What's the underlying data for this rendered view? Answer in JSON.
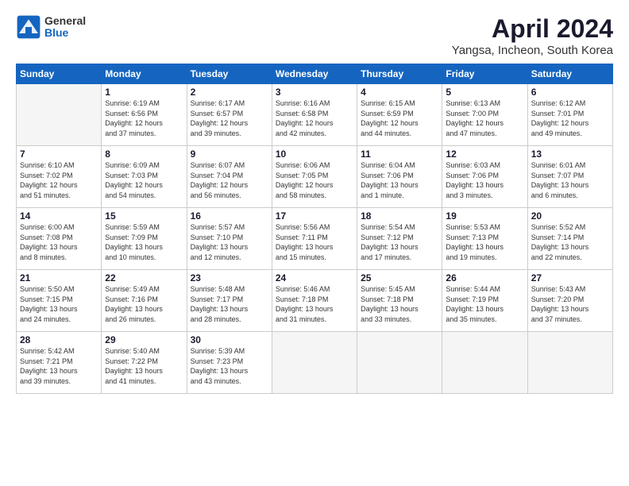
{
  "logo": {
    "general": "General",
    "blue": "Blue"
  },
  "title": "April 2024",
  "subtitle": "Yangsa, Incheon, South Korea",
  "weekdays": [
    "Sunday",
    "Monday",
    "Tuesday",
    "Wednesday",
    "Thursday",
    "Friday",
    "Saturday"
  ],
  "weeks": [
    [
      {
        "day": "",
        "empty": true
      },
      {
        "day": "1",
        "sunrise": "Sunrise: 6:19 AM",
        "sunset": "Sunset: 6:56 PM",
        "daylight": "Daylight: 12 hours and 37 minutes."
      },
      {
        "day": "2",
        "sunrise": "Sunrise: 6:17 AM",
        "sunset": "Sunset: 6:57 PM",
        "daylight": "Daylight: 12 hours and 39 minutes."
      },
      {
        "day": "3",
        "sunrise": "Sunrise: 6:16 AM",
        "sunset": "Sunset: 6:58 PM",
        "daylight": "Daylight: 12 hours and 42 minutes."
      },
      {
        "day": "4",
        "sunrise": "Sunrise: 6:15 AM",
        "sunset": "Sunset: 6:59 PM",
        "daylight": "Daylight: 12 hours and 44 minutes."
      },
      {
        "day": "5",
        "sunrise": "Sunrise: 6:13 AM",
        "sunset": "Sunset: 7:00 PM",
        "daylight": "Daylight: 12 hours and 47 minutes."
      },
      {
        "day": "6",
        "sunrise": "Sunrise: 6:12 AM",
        "sunset": "Sunset: 7:01 PM",
        "daylight": "Daylight: 12 hours and 49 minutes."
      }
    ],
    [
      {
        "day": "7",
        "sunrise": "Sunrise: 6:10 AM",
        "sunset": "Sunset: 7:02 PM",
        "daylight": "Daylight: 12 hours and 51 minutes."
      },
      {
        "day": "8",
        "sunrise": "Sunrise: 6:09 AM",
        "sunset": "Sunset: 7:03 PM",
        "daylight": "Daylight: 12 hours and 54 minutes."
      },
      {
        "day": "9",
        "sunrise": "Sunrise: 6:07 AM",
        "sunset": "Sunset: 7:04 PM",
        "daylight": "Daylight: 12 hours and 56 minutes."
      },
      {
        "day": "10",
        "sunrise": "Sunrise: 6:06 AM",
        "sunset": "Sunset: 7:05 PM",
        "daylight": "Daylight: 12 hours and 58 minutes."
      },
      {
        "day": "11",
        "sunrise": "Sunrise: 6:04 AM",
        "sunset": "Sunset: 7:06 PM",
        "daylight": "Daylight: 13 hours and 1 minute."
      },
      {
        "day": "12",
        "sunrise": "Sunrise: 6:03 AM",
        "sunset": "Sunset: 7:06 PM",
        "daylight": "Daylight: 13 hours and 3 minutes."
      },
      {
        "day": "13",
        "sunrise": "Sunrise: 6:01 AM",
        "sunset": "Sunset: 7:07 PM",
        "daylight": "Daylight: 13 hours and 6 minutes."
      }
    ],
    [
      {
        "day": "14",
        "sunrise": "Sunrise: 6:00 AM",
        "sunset": "Sunset: 7:08 PM",
        "daylight": "Daylight: 13 hours and 8 minutes."
      },
      {
        "day": "15",
        "sunrise": "Sunrise: 5:59 AM",
        "sunset": "Sunset: 7:09 PM",
        "daylight": "Daylight: 13 hours and 10 minutes."
      },
      {
        "day": "16",
        "sunrise": "Sunrise: 5:57 AM",
        "sunset": "Sunset: 7:10 PM",
        "daylight": "Daylight: 13 hours and 12 minutes."
      },
      {
        "day": "17",
        "sunrise": "Sunrise: 5:56 AM",
        "sunset": "Sunset: 7:11 PM",
        "daylight": "Daylight: 13 hours and 15 minutes."
      },
      {
        "day": "18",
        "sunrise": "Sunrise: 5:54 AM",
        "sunset": "Sunset: 7:12 PM",
        "daylight": "Daylight: 13 hours and 17 minutes."
      },
      {
        "day": "19",
        "sunrise": "Sunrise: 5:53 AM",
        "sunset": "Sunset: 7:13 PM",
        "daylight": "Daylight: 13 hours and 19 minutes."
      },
      {
        "day": "20",
        "sunrise": "Sunrise: 5:52 AM",
        "sunset": "Sunset: 7:14 PM",
        "daylight": "Daylight: 13 hours and 22 minutes."
      }
    ],
    [
      {
        "day": "21",
        "sunrise": "Sunrise: 5:50 AM",
        "sunset": "Sunset: 7:15 PM",
        "daylight": "Daylight: 13 hours and 24 minutes."
      },
      {
        "day": "22",
        "sunrise": "Sunrise: 5:49 AM",
        "sunset": "Sunset: 7:16 PM",
        "daylight": "Daylight: 13 hours and 26 minutes."
      },
      {
        "day": "23",
        "sunrise": "Sunrise: 5:48 AM",
        "sunset": "Sunset: 7:17 PM",
        "daylight": "Daylight: 13 hours and 28 minutes."
      },
      {
        "day": "24",
        "sunrise": "Sunrise: 5:46 AM",
        "sunset": "Sunset: 7:18 PM",
        "daylight": "Daylight: 13 hours and 31 minutes."
      },
      {
        "day": "25",
        "sunrise": "Sunrise: 5:45 AM",
        "sunset": "Sunset: 7:18 PM",
        "daylight": "Daylight: 13 hours and 33 minutes."
      },
      {
        "day": "26",
        "sunrise": "Sunrise: 5:44 AM",
        "sunset": "Sunset: 7:19 PM",
        "daylight": "Daylight: 13 hours and 35 minutes."
      },
      {
        "day": "27",
        "sunrise": "Sunrise: 5:43 AM",
        "sunset": "Sunset: 7:20 PM",
        "daylight": "Daylight: 13 hours and 37 minutes."
      }
    ],
    [
      {
        "day": "28",
        "sunrise": "Sunrise: 5:42 AM",
        "sunset": "Sunset: 7:21 PM",
        "daylight": "Daylight: 13 hours and 39 minutes."
      },
      {
        "day": "29",
        "sunrise": "Sunrise: 5:40 AM",
        "sunset": "Sunset: 7:22 PM",
        "daylight": "Daylight: 13 hours and 41 minutes."
      },
      {
        "day": "30",
        "sunrise": "Sunrise: 5:39 AM",
        "sunset": "Sunset: 7:23 PM",
        "daylight": "Daylight: 13 hours and 43 minutes."
      },
      {
        "day": "",
        "empty": true
      },
      {
        "day": "",
        "empty": true
      },
      {
        "day": "",
        "empty": true
      },
      {
        "day": "",
        "empty": true
      }
    ]
  ],
  "colors": {
    "header_bg": "#1565c0",
    "header_text": "#ffffff",
    "border": "#cccccc",
    "empty_bg": "#f5f5f5"
  }
}
